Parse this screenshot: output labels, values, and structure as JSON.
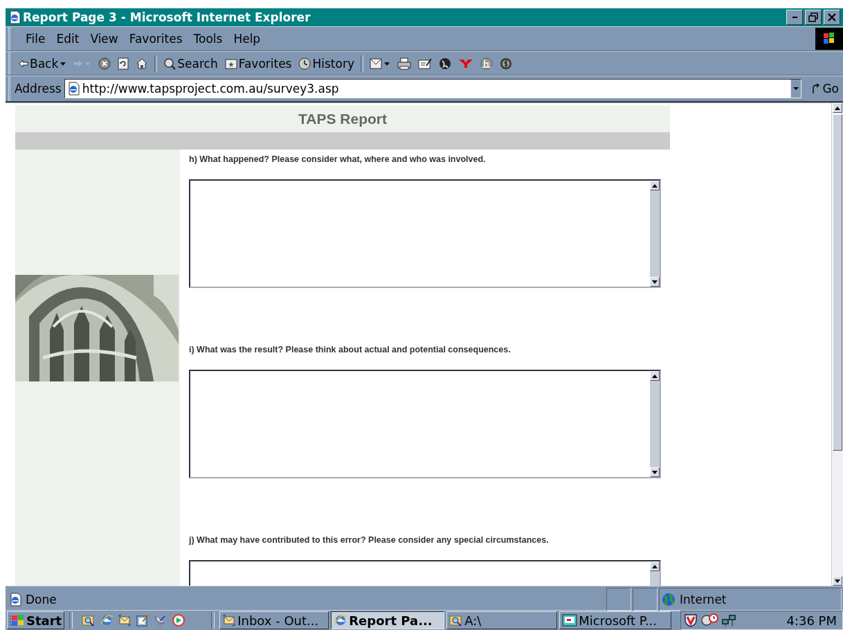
{
  "window": {
    "title": "Report Page 3 - Microsoft Internet Explorer"
  },
  "menu": [
    {
      "label": "File"
    },
    {
      "label": "Edit"
    },
    {
      "label": "View"
    },
    {
      "label": "Favorites"
    },
    {
      "label": "Tools"
    },
    {
      "label": "Help"
    }
  ],
  "toolbar": [
    {
      "kind": "back",
      "label": "Back",
      "disabled": false
    },
    {
      "kind": "forward",
      "disabled": true
    },
    {
      "kind": "stop",
      "disabled": false
    },
    {
      "kind": "refresh",
      "disabled": false
    },
    {
      "kind": "home",
      "disabled": false
    },
    {
      "kind": "separator"
    },
    {
      "kind": "search",
      "label": "Search",
      "disabled": false
    },
    {
      "kind": "favorites",
      "label": "Favorites",
      "disabled": false
    },
    {
      "kind": "history",
      "label": "History",
      "disabled": false
    },
    {
      "kind": "separator"
    },
    {
      "kind": "mail",
      "disabled": false
    },
    {
      "kind": "print",
      "disabled": false
    },
    {
      "kind": "edit",
      "disabled": false
    },
    {
      "kind": "messenger",
      "disabled": false
    },
    {
      "kind": "yahoo",
      "disabled": false
    },
    {
      "kind": "hbadge",
      "disabled": false
    },
    {
      "kind": "coin",
      "disabled": false
    }
  ],
  "address": {
    "label": "Address",
    "url": "http://www.tapsproject.com.au/survey3.asp",
    "go": "Go"
  },
  "page": {
    "header": "TAPS Report",
    "questions": [
      {
        "label": "h) What happened? Please consider what, where and who was involved."
      },
      {
        "label": "i) What was the result? Please think about actual and potential consequences."
      },
      {
        "label": "j) What may have contributed to this error? Please consider any special circumstances."
      }
    ]
  },
  "status_bar": {
    "text": "Done",
    "zone": "Internet"
  },
  "taskbar": {
    "start": "Start",
    "quick_launch": [
      {
        "kind": "find"
      },
      {
        "kind": "ie"
      },
      {
        "kind": "outlook"
      },
      {
        "kind": "notepad"
      },
      {
        "kind": "dish"
      },
      {
        "kind": "player"
      }
    ],
    "tasks": [
      {
        "kind": "outlook",
        "label": "Inbox - Out...",
        "selected": false
      },
      {
        "kind": "ie",
        "label": "Report Pa...",
        "selected": true
      },
      {
        "kind": "find",
        "label": "A:\\",
        "selected": false
      },
      {
        "kind": "ppt",
        "label": "Microsoft P...",
        "selected": false
      }
    ],
    "tray": [
      {
        "kind": "shield"
      },
      {
        "kind": "magnifier"
      },
      {
        "kind": "network"
      }
    ],
    "clock": "4:36 PM"
  }
}
